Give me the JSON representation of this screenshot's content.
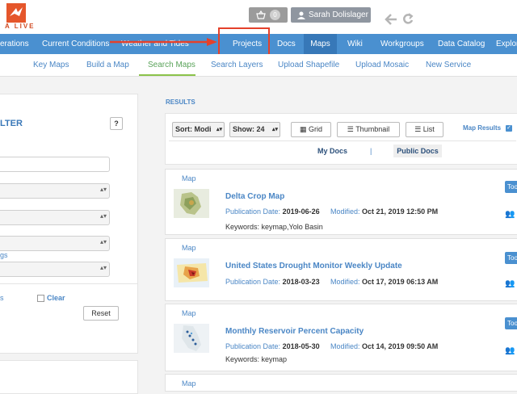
{
  "header": {
    "logo_text": "A LIVE",
    "cart_count": "0",
    "user_name": "Sarah Dolislager",
    "back_icon": "arrow-left-icon",
    "refresh_icon": "refresh-icon"
  },
  "nav": {
    "items": [
      "erations",
      "Current Conditions",
      "Weather and Tides",
      "Projects",
      "Docs",
      "Maps",
      "Wiki",
      "Workgroups",
      "Data Catalog",
      "Explor"
    ],
    "active": "Maps"
  },
  "subnav": {
    "items": [
      "Key Maps",
      "Build a Map",
      "Search Maps",
      "Search Layers",
      "Upload Shapefile",
      "Upload Mosaic",
      "New Service"
    ],
    "active": "Search Maps"
  },
  "filter": {
    "title": "LTER",
    "help": "?",
    "link_partial": "gs",
    "link2_partial": "s",
    "clear_label": "Clear",
    "reset_label": "Reset"
  },
  "results": {
    "heading": "RESULTS",
    "sort_label": "Sort: Modi",
    "show_label": "Show: 24",
    "grid_label": "Grid",
    "thumbnail_label": "Thumbnail",
    "list_label": "List",
    "map_results_label": "Map Results",
    "my_docs": "My Docs",
    "separator": "|",
    "public_docs": "Public Docs",
    "pub_date_label": "Publication Date:",
    "modified_label": "Modified:",
    "keywords_label": "Keywords:",
    "tool_label": "Too",
    "items": [
      {
        "type": "Map",
        "title": "Delta Crop Map",
        "pub_date": "2019-06-26",
        "modified": "Oct 21, 2019 12:50 PM",
        "keywords": "keymap,Yolo Basin"
      },
      {
        "type": "Map",
        "title": "United States Drought Monitor Weekly Update",
        "pub_date": "2018-03-23",
        "modified": "Oct 17, 2019 06:13 AM",
        "keywords": ""
      },
      {
        "type": "Map",
        "title": "Monthly Reservoir Percent Capacity",
        "pub_date": "2018-05-30",
        "modified": "Oct 14, 2019 09:50 AM",
        "keywords": "keymap"
      },
      {
        "type": "Map"
      }
    ]
  },
  "colors": {
    "nav": "#4a90d0",
    "nav_active": "#3778b8",
    "annotation": "#e4412b",
    "link": "#4a86c5"
  }
}
